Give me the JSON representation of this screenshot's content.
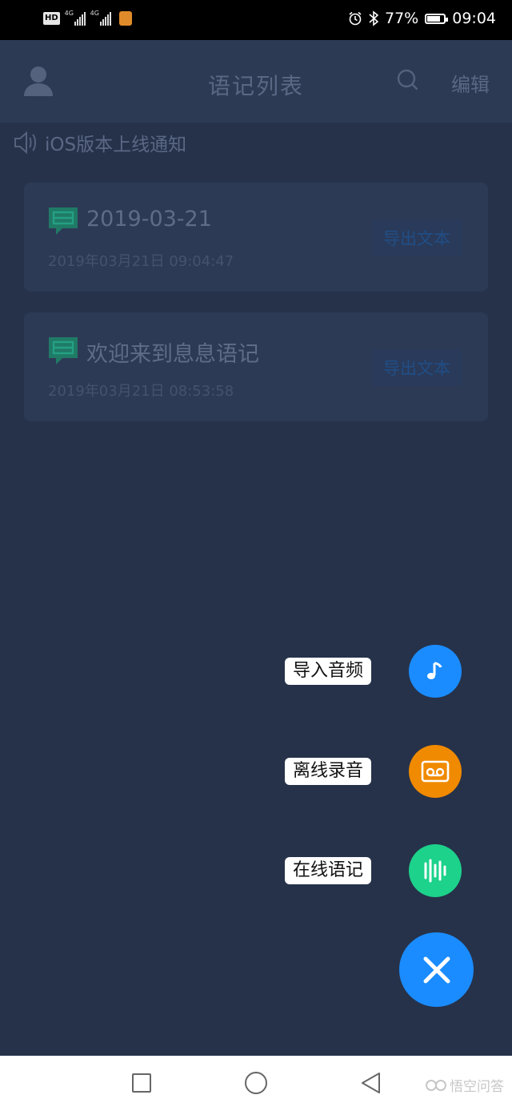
{
  "status_bar": {
    "network_badge": "HD",
    "sim1_tag": "4G",
    "sim2_tag": "4G",
    "battery_percent": "77%",
    "battery_level": 0.77,
    "time": "09:04"
  },
  "header": {
    "title": "语记列表",
    "edit_label": "编辑"
  },
  "notice": {
    "text": "iOS版本上线通知"
  },
  "notes": [
    {
      "title": "2019-03-21",
      "datetime": "2019年03月21日 09:04:47",
      "export_label": "导出文本"
    },
    {
      "title": "欢迎来到息息语记",
      "datetime": "2019年03月21日 08:53:58",
      "export_label": "导出文本"
    }
  ],
  "fab_menu": {
    "items": [
      {
        "label": "导入音频",
        "icon": "music-note-icon",
        "color": "#1a8cff"
      },
      {
        "label": "离线录音",
        "icon": "voicemail-icon",
        "color": "#f08a00"
      },
      {
        "label": "在线语记",
        "icon": "sound-wave-icon",
        "color": "#1dd28b"
      }
    ],
    "close_icon": "close-icon",
    "close_color": "#1a8cff"
  },
  "watermark": {
    "text": "悟空问答"
  },
  "colors": {
    "background": "#26324a",
    "header": "#2c3a54",
    "card": "#2d3a55",
    "accent_green": "#1f8a6e"
  }
}
